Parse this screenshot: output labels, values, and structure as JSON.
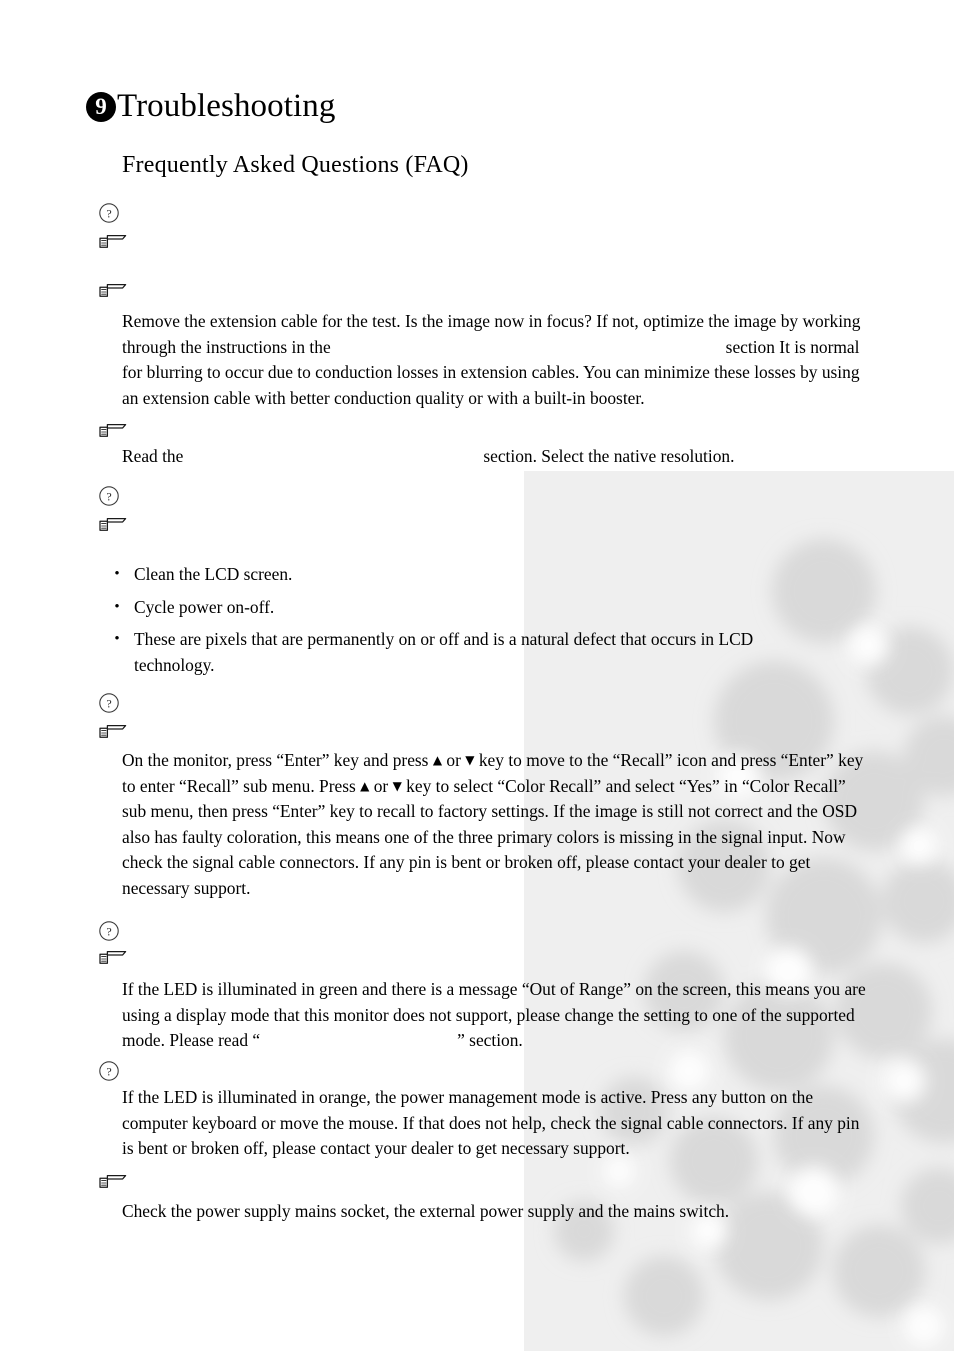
{
  "page": {
    "chapter_number": "9",
    "chapter_title": "Troubleshooting",
    "section_title": "Frequently Asked Questions (FAQ)"
  },
  "icons": {
    "question": "question-circle-icon",
    "answer": "pointing-hand-icon",
    "bullet": "•",
    "arrow_up": "▲",
    "arrow_down": "▼"
  },
  "entries": [
    {
      "id": "q1",
      "marker": "question",
      "question": "",
      "answer": ""
    },
    {
      "id": "a1",
      "marker": "answer",
      "text": ""
    },
    {
      "id": "a2",
      "marker": "answer",
      "text_parts": {
        "before": "Remove the extension cable for the test. Is the image now in focus? If not, optimize the image by working through the instructions in the",
        "reference": "",
        "after": "section It is normal for blurring to occur due to conduction losses in extension cables. You can minimize these losses by using an extension cable with better conduction quality or with a built-in booster."
      }
    },
    {
      "id": "a3",
      "marker": "answer",
      "text_parts": {
        "before": "Read the",
        "reference": "",
        "after": "section. Select the native resolution."
      }
    },
    {
      "id": "q2",
      "marker": "question",
      "question": ""
    },
    {
      "id": "a4",
      "marker": "answer",
      "text": "",
      "bullets": [
        "Clean the LCD screen.",
        "Cycle power on-off.",
        "These are pixels that are permanently on or off and is a natural defect that occurs in LCD technology."
      ]
    },
    {
      "id": "q3",
      "marker": "question",
      "question": ""
    },
    {
      "id": "a5",
      "marker": "answer",
      "text_parts": {
        "p1": "On the monitor, press “Enter” key and press",
        "p2": "or",
        "p3": "key to move to the “Recall” icon and press “Enter” key to enter “Recall” sub menu. Press",
        "p4": "or",
        "p5": "key to select “Color Recall” and select “Yes” in “Color Recall” sub menu, then press “Enter” key to recall to factory settings. If the image is still not correct and the OSD also has faulty coloration, this means one of the three primary colors is missing in the signal input. Now check the signal cable connectors. If any pin is bent or broken off, please contact your dealer to get necessary support."
      }
    },
    {
      "id": "q4",
      "marker": "question",
      "question": ""
    },
    {
      "id": "a6",
      "marker": "answer",
      "text_parts": {
        "before": "If the LED is illuminated in green and there is a message “Out of Range” on the screen, this means you are using a display mode that this monitor does not support, please change the setting to one of the supported mode. Please read “",
        "reference": "",
        "after": "” section."
      }
    },
    {
      "id": "q5",
      "marker": "question",
      "question": "",
      "text": "If the LED is illuminated in orange, the power management mode is active. Press any button on the computer keyboard or move the mouse. If that does not help, check the signal cable connectors. If any pin is bent or broken off, please contact your dealer to get necessary support."
    },
    {
      "id": "a7",
      "marker": "answer",
      "text": "Check the power supply mains socket, the external power supply and the mains switch."
    }
  ],
  "colors": {
    "text": "#000000",
    "background": "#ffffff",
    "watermark": "#e8e8e8"
  }
}
